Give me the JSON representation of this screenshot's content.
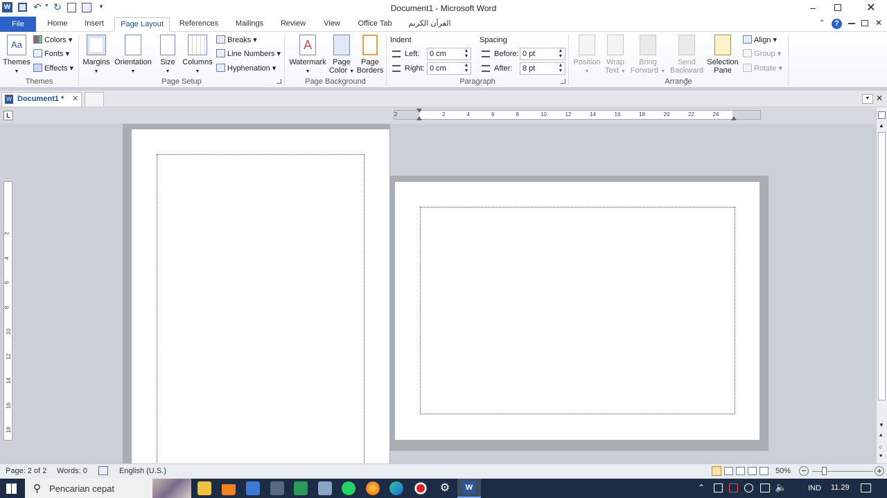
{
  "titlebar": {
    "title": "Document1  -  Microsoft Word"
  },
  "ribbon_tabs": [
    "File",
    "Home",
    "Insert",
    "Page Layout",
    "References",
    "Mailings",
    "Review",
    "View",
    "Office Tab",
    "القرآن الكريم"
  ],
  "ribbon": {
    "themes": {
      "themes_label": "Themes",
      "colors_label": "Colors",
      "fonts_label": "Fonts",
      "effects_label": "Effects",
      "group_label": "Themes"
    },
    "page_setup": {
      "margins_label": "Margins",
      "orientation_label": "Orientation",
      "size_label": "Size",
      "columns_label": "Columns",
      "breaks_label": "Breaks",
      "line_numbers_label": "Line Numbers",
      "hyphenation_label": "Hyphenation",
      "group_label": "Page Setup"
    },
    "page_background": {
      "watermark_label": "Watermark",
      "page_color_label1": "Page",
      "page_color_label2": "Color",
      "page_borders_label1": "Page",
      "page_borders_label2": "Borders",
      "group_label": "Page Background"
    },
    "paragraph": {
      "indent_header": "Indent",
      "left_label": "Left:",
      "left_value": "0 cm",
      "right_label": "Right:",
      "right_value": "0 cm",
      "spacing_header": "Spacing",
      "before_label": "Before:",
      "before_value": "0 pt",
      "after_label": "After:",
      "after_value": "8 pt",
      "group_label": "Paragraph"
    },
    "arrange": {
      "position_label": "Position",
      "wrap_label1": "Wrap",
      "wrap_label2": "Text",
      "bring_label1": "Bring",
      "bring_label2": "Forward",
      "send_label1": "Send",
      "send_label2": "Backward",
      "selection_label1": "Selection",
      "selection_label2": "Pane",
      "align_label": "Align",
      "group_btn_label": "Group",
      "rotate_label": "Rotate",
      "group_label": "Arrange"
    }
  },
  "doc_tab": {
    "label": "Document1 *"
  },
  "ruler": {
    "numbers": [
      "2",
      "2",
      "4",
      "6",
      "8",
      "10",
      "12",
      "14",
      "16",
      "18",
      "20",
      "22",
      "24"
    ]
  },
  "vruler": {
    "numbers": [
      "2",
      "4",
      "6",
      "8",
      "10",
      "12",
      "14",
      "16",
      "18"
    ]
  },
  "statusbar": {
    "page": "Page: 2 of 2",
    "words": "Words: 0",
    "language": "English (U.S.)",
    "zoom": "50%"
  },
  "taskbar": {
    "search_placeholder": "Pencarian cepat",
    "lang": "IND",
    "time": "11.29"
  }
}
